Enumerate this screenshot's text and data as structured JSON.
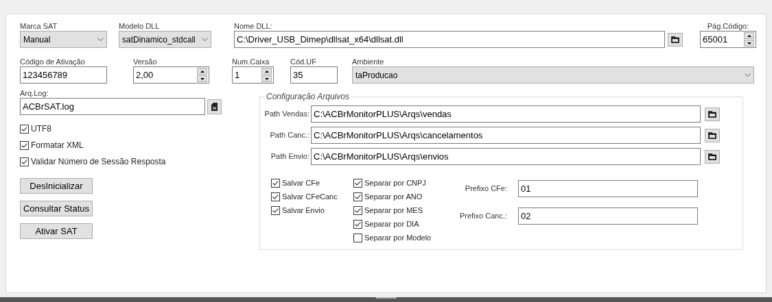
{
  "row1": [
    {
      "kind": "select",
      "label": "Marca SAT",
      "value": "Manual"
    },
    {
      "kind": "select",
      "label": "Modelo DLL",
      "value": "satDinamico_stdcall"
    },
    {
      "kind": "path",
      "label": "Nome DLL:",
      "value": "C:\\Driver_USB_Dimep\\dllsat_x64\\dllsat.dll"
    },
    {
      "kind": "spin",
      "label": "Pág.Código:",
      "value": "65001"
    }
  ],
  "row2": [
    {
      "kind": "text",
      "label": "Código de Ativação",
      "value": "123456789"
    },
    {
      "kind": "spin",
      "label": "Versão",
      "value": "2,00"
    },
    {
      "kind": "spin",
      "label": "Num.Caixa",
      "value": "1"
    },
    {
      "kind": "text",
      "label": "Cód.UF",
      "value": "35"
    },
    {
      "kind": "select",
      "label": "Ambiente",
      "value": "taProducao"
    }
  ],
  "log": {
    "label": "Arq.Log:",
    "value": "ACBrSAT.log"
  },
  "options": [
    {
      "label": "UTF8",
      "checked": true
    },
    {
      "label": "Formatar XML",
      "checked": true
    },
    {
      "label": "Validar Número de Sessão Resposta",
      "checked": true
    }
  ],
  "buttons": [
    "DesInicializar",
    "Consultar Status",
    "Ativar SAT"
  ],
  "files": {
    "title": "Configuração Arquivos",
    "paths": [
      {
        "label": "Path Vendas:",
        "value": "C:\\ACBrMonitorPLUS\\Arqs\\vendas"
      },
      {
        "label": "Path Canc.:",
        "value": "C:\\ACBrMonitorPLUS\\Arqs\\cancelamentos"
      },
      {
        "label": "Path Envio:",
        "value": "C:\\ACBrMonitorPLUS\\Arqs\\envios"
      }
    ],
    "save": [
      {
        "label": "Salvar CFe",
        "checked": true
      },
      {
        "label": "Salvar CFeCanc",
        "checked": true
      },
      {
        "label": "Salvar Envio",
        "checked": true
      }
    ],
    "separate": [
      {
        "label": "Separar por CNPJ",
        "checked": true
      },
      {
        "label": "Separar por ANO",
        "checked": true
      },
      {
        "label": "Separar por MES",
        "checked": true
      },
      {
        "label": "Separar por DIA",
        "checked": true
      },
      {
        "label": "Separar por Modelo",
        "checked": false
      }
    ],
    "prefixes": [
      {
        "label": "Prefixo CFe:",
        "value": "01"
      },
      {
        "label": "Prefixo Canc.:",
        "value": "02"
      }
    ]
  }
}
